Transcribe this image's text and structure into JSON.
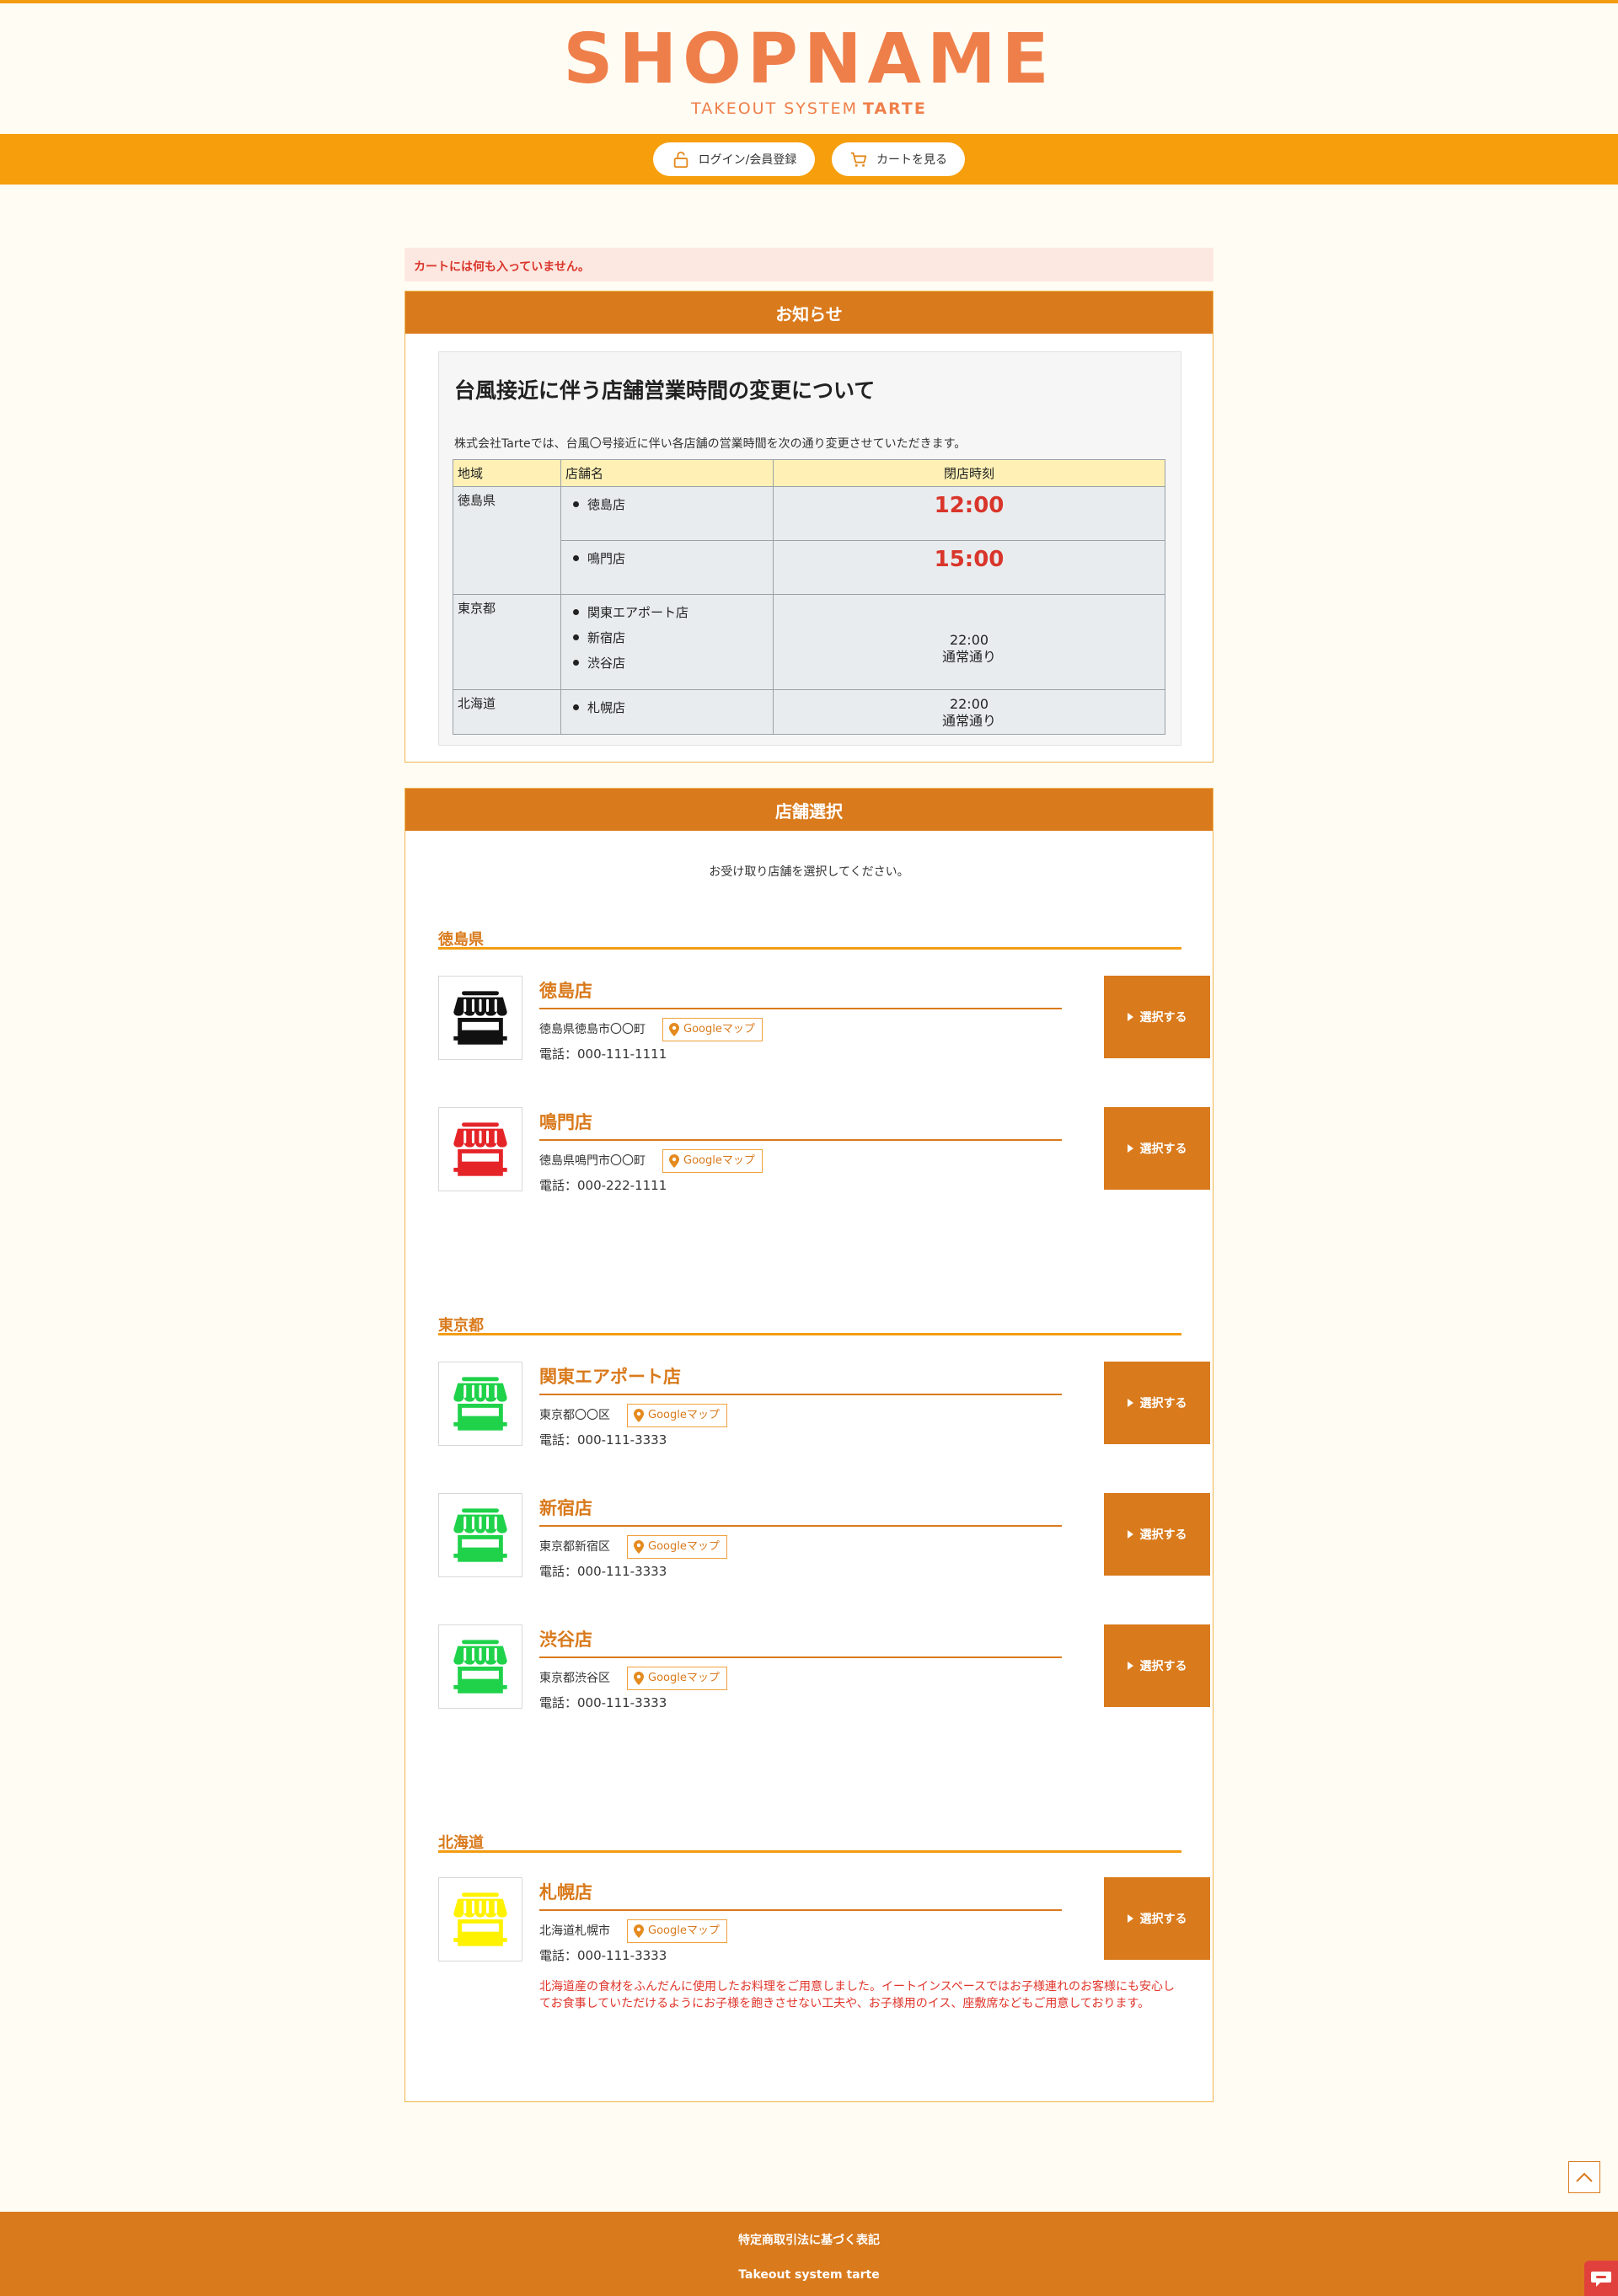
{
  "header": {
    "logo": "SHOPNAME",
    "tagline": "TAKEOUT SYSTEM",
    "tagline_brand": "TARTE"
  },
  "nav": {
    "login_label": "ログイン/会員登録",
    "cart_label": "カートを見る"
  },
  "alert": "カートには何も入っていません。",
  "notice": {
    "heading": "お知らせ",
    "title": "台風接近に伴う店舗営業時間の変更について",
    "text": "株式会社Tarteでは、台風〇号接近に伴い各店舗の営業時間を次の通り変更させていただきます。",
    "columns": [
      "地域",
      "店舗名",
      "閉店時刻"
    ],
    "rows": [
      {
        "region": "徳島県",
        "stores": [
          "徳島店"
        ],
        "time": "12:00",
        "note": ""
      },
      {
        "region": "",
        "stores": [
          "鳴門店"
        ],
        "time": "15:00",
        "note": ""
      },
      {
        "region": "東京都",
        "stores": [
          "関東エアポート店",
          "新宿店",
          "渋谷店"
        ],
        "time": "22:00",
        "note": "通常通り"
      },
      {
        "region": "北海道",
        "stores": [
          "札幌店"
        ],
        "time": "22:00",
        "note": "通常通り"
      }
    ]
  },
  "store_select": {
    "heading": "店舗選択",
    "intro": "お受け取り店舗を選択してください。",
    "select_label": "選択する",
    "map_label": "Googleマップ",
    "regions": [
      {
        "name": "徳島県",
        "stores": [
          {
            "name": "徳島店",
            "address": "徳島県徳島市〇〇町",
            "tel": "電話：000-111-1111",
            "icon_color": "#111111",
            "note": ""
          },
          {
            "name": "鳴門店",
            "address": "徳島県鳴門市〇〇町",
            "tel": "電話：000-222-1111",
            "icon_color": "#e52428",
            "note": ""
          }
        ]
      },
      {
        "name": "東京都",
        "stores": [
          {
            "name": "関東エアポート店",
            "address": "東京都〇〇区",
            "tel": "電話：000-111-3333",
            "icon_color": "#1fd24a",
            "note": ""
          },
          {
            "name": "新宿店",
            "address": "東京都新宿区",
            "tel": "電話：000-111-3333",
            "icon_color": "#1fd24a",
            "note": ""
          },
          {
            "name": "渋谷店",
            "address": "東京都渋谷区",
            "tel": "電話：000-111-3333",
            "icon_color": "#1fd24a",
            "note": ""
          }
        ]
      },
      {
        "name": "北海道",
        "stores": [
          {
            "name": "札幌店",
            "address": "北海道札幌市",
            "tel": "電話：000-111-3333",
            "icon_color": "#fff200",
            "note": "北海道産の食材をふんだんに使用したお料理をご用意しました。イートインスペースではお子様連れのお客様にも安心してお食事していただけるようにお子様を飽きさせない工夫や、お子様用のイス、座敷席などもご用意しております。"
          }
        ]
      }
    ]
  },
  "footer": {
    "legal_link": "特定商取引法に基づく表記",
    "copyright": "Takeout system tarte"
  },
  "colors": {
    "accent": "#d97a1c",
    "nav_bar": "#f69e0b",
    "logo": "#ef7f4a",
    "alert_text": "#d9352b"
  }
}
